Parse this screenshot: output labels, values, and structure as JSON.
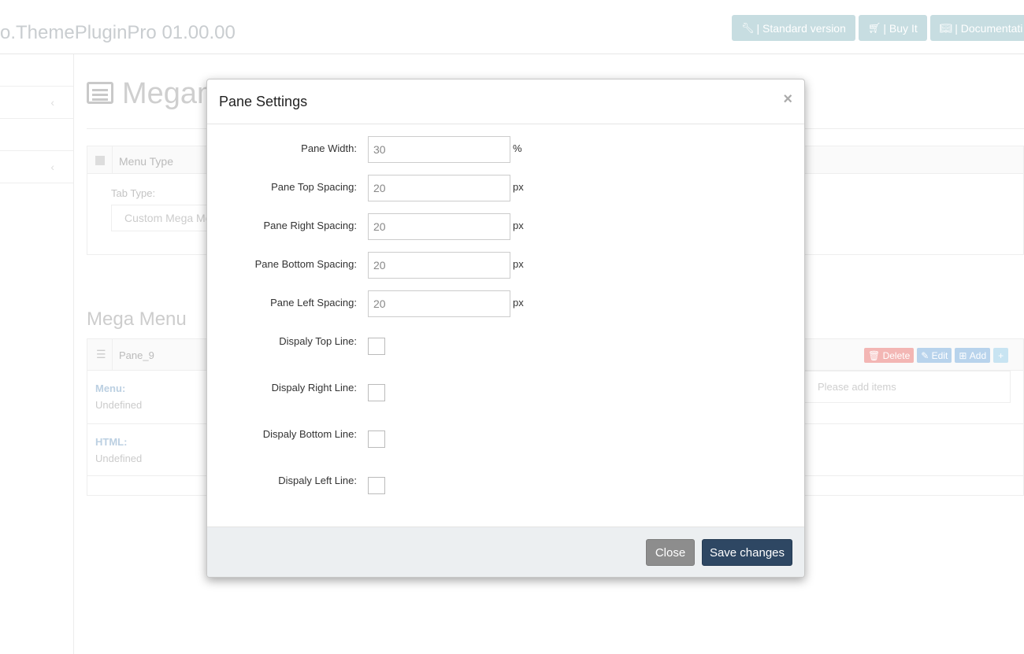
{
  "app": {
    "title": "o.ThemePluginPro 01.00.00"
  },
  "top_buttons": [
    {
      "label": "| Standard version",
      "icon": "wrench-icon"
    },
    {
      "label": "| Buy It",
      "icon": "cart-icon"
    },
    {
      "label": "| Documentati",
      "icon": "book-icon"
    }
  ],
  "page": {
    "title": "Megam",
    "menu_type_label": "Menu Type",
    "tab_type_label": "Tab Type:",
    "tab_type_value": "Custom Mega Me",
    "section_title": "Mega Menu",
    "pane_name": "Pane_9",
    "pane_actions": {
      "delete": "Delete",
      "edit": "Edit",
      "add": "Add"
    },
    "menu_label": "Menu:",
    "menu_value": "Undefined",
    "html_label": "HTML:",
    "html_value": "Undefined",
    "items_placeholder": "Please add items"
  },
  "modal": {
    "title": "Pane Settings",
    "close_symbol": "×",
    "fields": [
      {
        "label": "Pane Width:",
        "value": "30",
        "unit": "%"
      },
      {
        "label": "Pane Top Spacing:",
        "value": "20",
        "unit": "px"
      },
      {
        "label": "Pane Right Spacing:",
        "value": "20",
        "unit": "px"
      },
      {
        "label": "Pane Bottom Spacing:",
        "value": "20",
        "unit": "px"
      },
      {
        "label": "Pane Left Spacing:",
        "value": "20",
        "unit": "px"
      }
    ],
    "checkboxes": [
      {
        "label": "Dispaly Top Line:",
        "checked": false
      },
      {
        "label": "Dispaly Right Line:",
        "checked": false
      },
      {
        "label": "Dispaly Bottom Line:",
        "checked": false
      },
      {
        "label": "Dispaly Left Line:",
        "checked": false
      }
    ],
    "close_label": "Close",
    "save_label": "Save changes"
  },
  "colors": {
    "primary": "#2e4763",
    "secondary": "#8d8d8d",
    "delete": "#f3b6b4",
    "info": "#b8d3ec"
  }
}
